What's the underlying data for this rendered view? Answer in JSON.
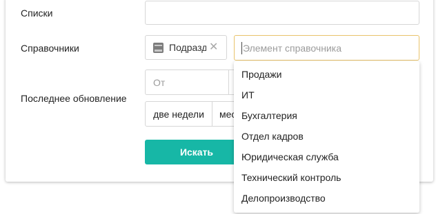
{
  "form": {
    "lists_label": "Списки",
    "directories_label": "Справочники",
    "last_update_label": "Последнее обновление",
    "lists_value": "",
    "selected_chip": "Подразделения",
    "search_placeholder": "Элемент справочника",
    "from_placeholder": "От",
    "period_buttons": [
      "две недели",
      "месяц"
    ],
    "search_button": "Искать"
  },
  "dropdown": {
    "items": [
      "Продажи",
      "ИТ",
      "Бухгалтерия",
      "Отдел кадров",
      "Юридическая служба",
      "Технический контроль",
      "Делопроизводство"
    ]
  },
  "colors": {
    "primary_button": "#17b7a6",
    "focus_border": "#e9c36a"
  }
}
